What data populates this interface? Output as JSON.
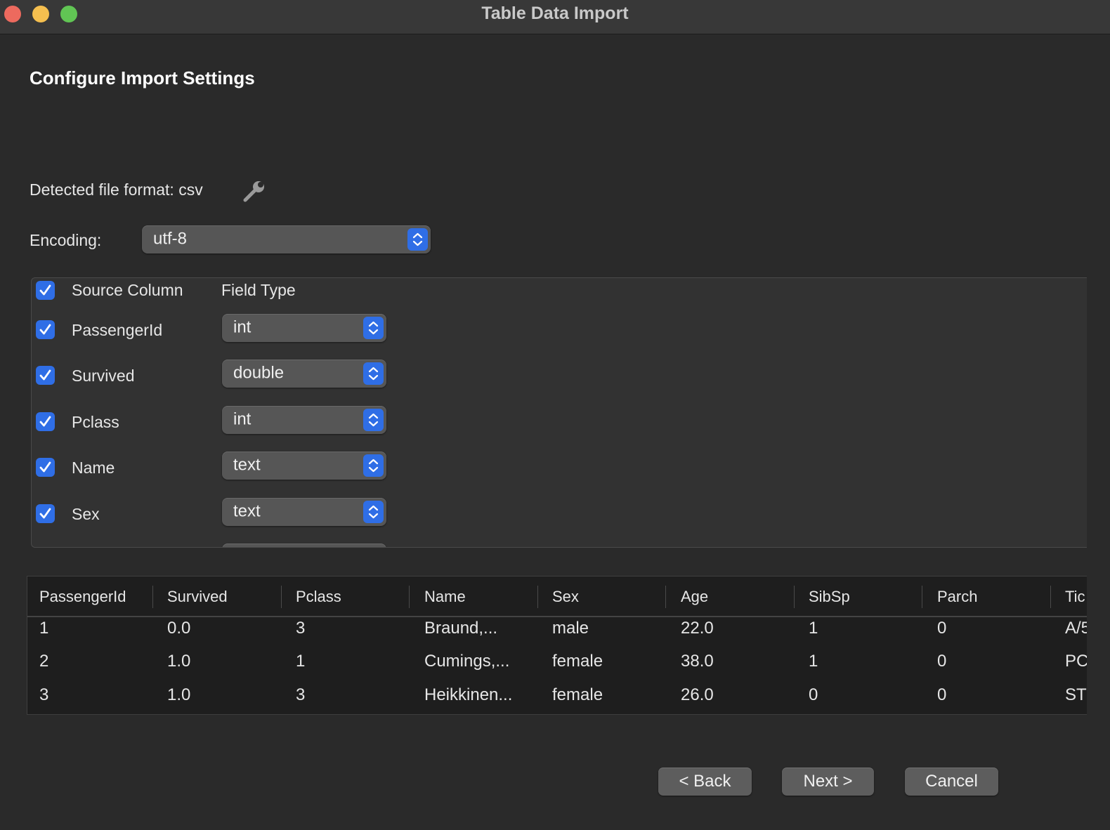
{
  "window": {
    "title": "Table Data Import"
  },
  "page": {
    "title": "Configure Import Settings"
  },
  "format": {
    "detected_label": "Detected file format: csv",
    "settings_icon": "wrench-icon"
  },
  "encoding": {
    "label": "Encoding:",
    "value": "utf-8"
  },
  "fields": {
    "header": {
      "source_column": "Source Column",
      "field_type": "Field Type",
      "all_checked": true
    },
    "rows": [
      {
        "name": "PassengerId",
        "type": "int",
        "checked": true
      },
      {
        "name": "Survived",
        "type": "double",
        "checked": true
      },
      {
        "name": "Pclass",
        "type": "int",
        "checked": true
      },
      {
        "name": "Name",
        "type": "text",
        "checked": true
      },
      {
        "name": "Sex",
        "type": "text",
        "checked": true
      }
    ]
  },
  "preview": {
    "columns": [
      "PassengerId",
      "Survived",
      "Pclass",
      "Name",
      "Sex",
      "Age",
      "SibSp",
      "Parch",
      "Tic"
    ],
    "rows": [
      [
        "1",
        "0.0",
        "3",
        "Braund,...",
        "male",
        "22.0",
        "1",
        "0",
        "A/5"
      ],
      [
        "2",
        "1.0",
        "1",
        "Cumings,...",
        "female",
        "38.0",
        "1",
        "0",
        "PC"
      ],
      [
        "3",
        "1.0",
        "3",
        "Heikkinen...",
        "female",
        "26.0",
        "0",
        "0",
        "ST"
      ]
    ]
  },
  "buttons": {
    "back": "< Back",
    "next": "Next >",
    "cancel": "Cancel"
  },
  "colors": {
    "accent": "#2f6ee6",
    "background": "#2a2a2a",
    "close": "#ed6a5e",
    "minimize": "#f5bf4f",
    "maximize": "#61c554"
  }
}
